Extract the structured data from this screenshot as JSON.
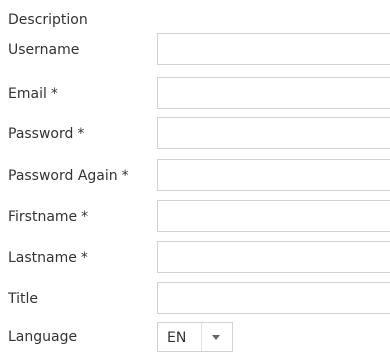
{
  "form": {
    "description_label": "Description",
    "required_marker": "*",
    "fields": [
      {
        "label": "Username",
        "required": false,
        "value": ""
      },
      {
        "label": "Email",
        "required": true,
        "value": ""
      },
      {
        "label": "Password",
        "required": true,
        "value": ""
      },
      {
        "label": "Password Again",
        "required": true,
        "value": ""
      },
      {
        "label": "Firstname",
        "required": true,
        "value": ""
      },
      {
        "label": "Lastname",
        "required": true,
        "value": ""
      },
      {
        "label": "Title",
        "required": false,
        "value": ""
      }
    ],
    "language": {
      "label": "Language",
      "selected": "EN"
    }
  }
}
